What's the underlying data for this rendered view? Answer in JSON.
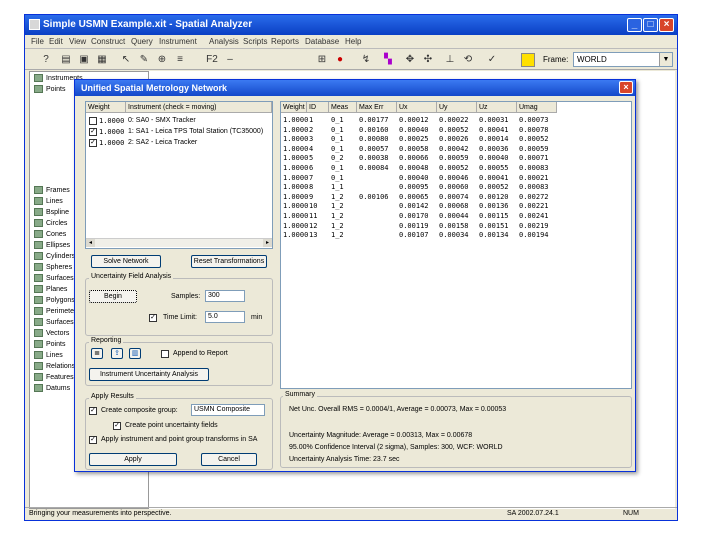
{
  "window": {
    "title": "Simple USMN Example.xit - Spatial Analyzer"
  },
  "menu": [
    "File",
    "Edit",
    "View",
    "Construct",
    "Query",
    "Instrument",
    "Analysis",
    "Scripts",
    "Reports",
    "Database",
    "Help"
  ],
  "toolbar": {
    "frame_label": "Frame:",
    "frame_value": "WORLD",
    "zoom_label": "F2"
  },
  "tree": {
    "items": [
      "Instruments",
      "Points",
      "Frames",
      "Lines",
      "Bspline",
      "Circles",
      "Cones",
      "Ellipses",
      "Cylinders",
      "Spheres",
      "Surfaces",
      "Planes",
      "Polygons",
      "Perimeters",
      "Surfaces",
      "Vectors",
      "Points",
      "Lines",
      "Relationships",
      "Features",
      "Datums"
    ]
  },
  "status": {
    "left": "Bringing your measurements into perspective.",
    "right": "SA 2002.07.24.1",
    "mode": "NUM"
  },
  "dialog": {
    "title": "Unified Spatial Metrology Network",
    "instruments": {
      "headers": [
        "Weight",
        "Instrument (check = moving)"
      ],
      "rows": [
        {
          "weight": "1.0000",
          "label": "0: SA0 - SMX Tracker",
          "checked": false
        },
        {
          "weight": "1.0000",
          "label": "1: SA1 - Leica TPS Total Station (TC35000)",
          "checked": true
        },
        {
          "weight": "1.0000",
          "label": "2: SA2 - Leica Tracker",
          "checked": true
        }
      ]
    },
    "solve_button": "Solve Network",
    "reset_button": "Reset Transformations",
    "uncertainty": {
      "title": "Uncertainty Field Analysis",
      "compute_button": "Begin",
      "samples_label": "Samples:",
      "samples_value": "300",
      "time_limit_label": "Time Limit:",
      "time_limit_value": "5.0",
      "time_unit": "min"
    },
    "reporting": {
      "title": "Reporting",
      "append_label": "Append to Report",
      "ua_button": "Instrument Uncertainty Analysis"
    },
    "apply_results": {
      "title": "Apply Results",
      "create_group_label": "Create composite group:",
      "group_name": "USMN Composite",
      "create_point_label": "Create point uncertainty fields",
      "apply_label": "Apply instrument and point group transforms in SA",
      "apply_button": "Apply",
      "cancel_button": "Cancel"
    },
    "results": {
      "headers": [
        "Weight",
        "ID",
        "Meas",
        "Max Err",
        "Ux",
        "Uy",
        "Uz",
        "Umag"
      ],
      "rows": [
        [
          "1.0000",
          "1",
          "0_1",
          "0.00177",
          "0.00012",
          "0.00022",
          "0.00031",
          "0.00073"
        ],
        [
          "1.0000",
          "2",
          "0_1",
          "0.00160",
          "0.00040",
          "0.00052",
          "0.00041",
          "0.00078"
        ],
        [
          "1.0000",
          "3",
          "0_1",
          "0.00080",
          "0.00025",
          "0.00026",
          "0.00014",
          "0.00052"
        ],
        [
          "1.0000",
          "4",
          "0_1",
          "0.00057",
          "0.00058",
          "0.00042",
          "0.00036",
          "0.00059"
        ],
        [
          "1.0000",
          "5",
          "0_2",
          "0.00038",
          "0.00066",
          "0.00059",
          "0.00040",
          "0.00071"
        ],
        [
          "1.0000",
          "6",
          "0_1",
          "0.00084",
          "0.00048",
          "0.00052",
          "0.00055",
          "0.00083"
        ],
        [
          "1.0000",
          "7",
          "0_1",
          "",
          "0.00040",
          "0.00046",
          "0.00041",
          "0.00021"
        ],
        [
          "1.0000",
          "8",
          "1_1",
          "",
          "0.00095",
          "0.00060",
          "0.00052",
          "0.00083"
        ],
        [
          "1.0000",
          "9",
          "1_2",
          "0.00106",
          "0.00065",
          "0.00074",
          "0.00120",
          "0.00272"
        ],
        [
          "1.0000",
          "10",
          "1_2",
          "",
          "0.00142",
          "0.00068",
          "0.00136",
          "0.00221"
        ],
        [
          "1.0000",
          "11",
          "1_2",
          "",
          "0.00170",
          "0.00044",
          "0.00115",
          "0.00241"
        ],
        [
          "1.0000",
          "12",
          "1_2",
          "",
          "0.00119",
          "0.00158",
          "0.00151",
          "0.00219"
        ],
        [
          "1.0000",
          "13",
          "1_2",
          "",
          "0.00107",
          "0.00034",
          "0.00134",
          "0.00194"
        ]
      ]
    },
    "summary": {
      "title": "Summary",
      "lines": [
        "Net Unc. Overall RMS = 0.0004/1, Average = 0.00073, Max = 0.00053",
        "Uncertainty Magnitude: Average = 0.00313, Max = 0.00678",
        "95.00% Confidence Interval (2 sigma), Samples: 300, WCF: WORLD",
        "Uncertainty Analysis Time: 23.7 sec"
      ]
    }
  }
}
